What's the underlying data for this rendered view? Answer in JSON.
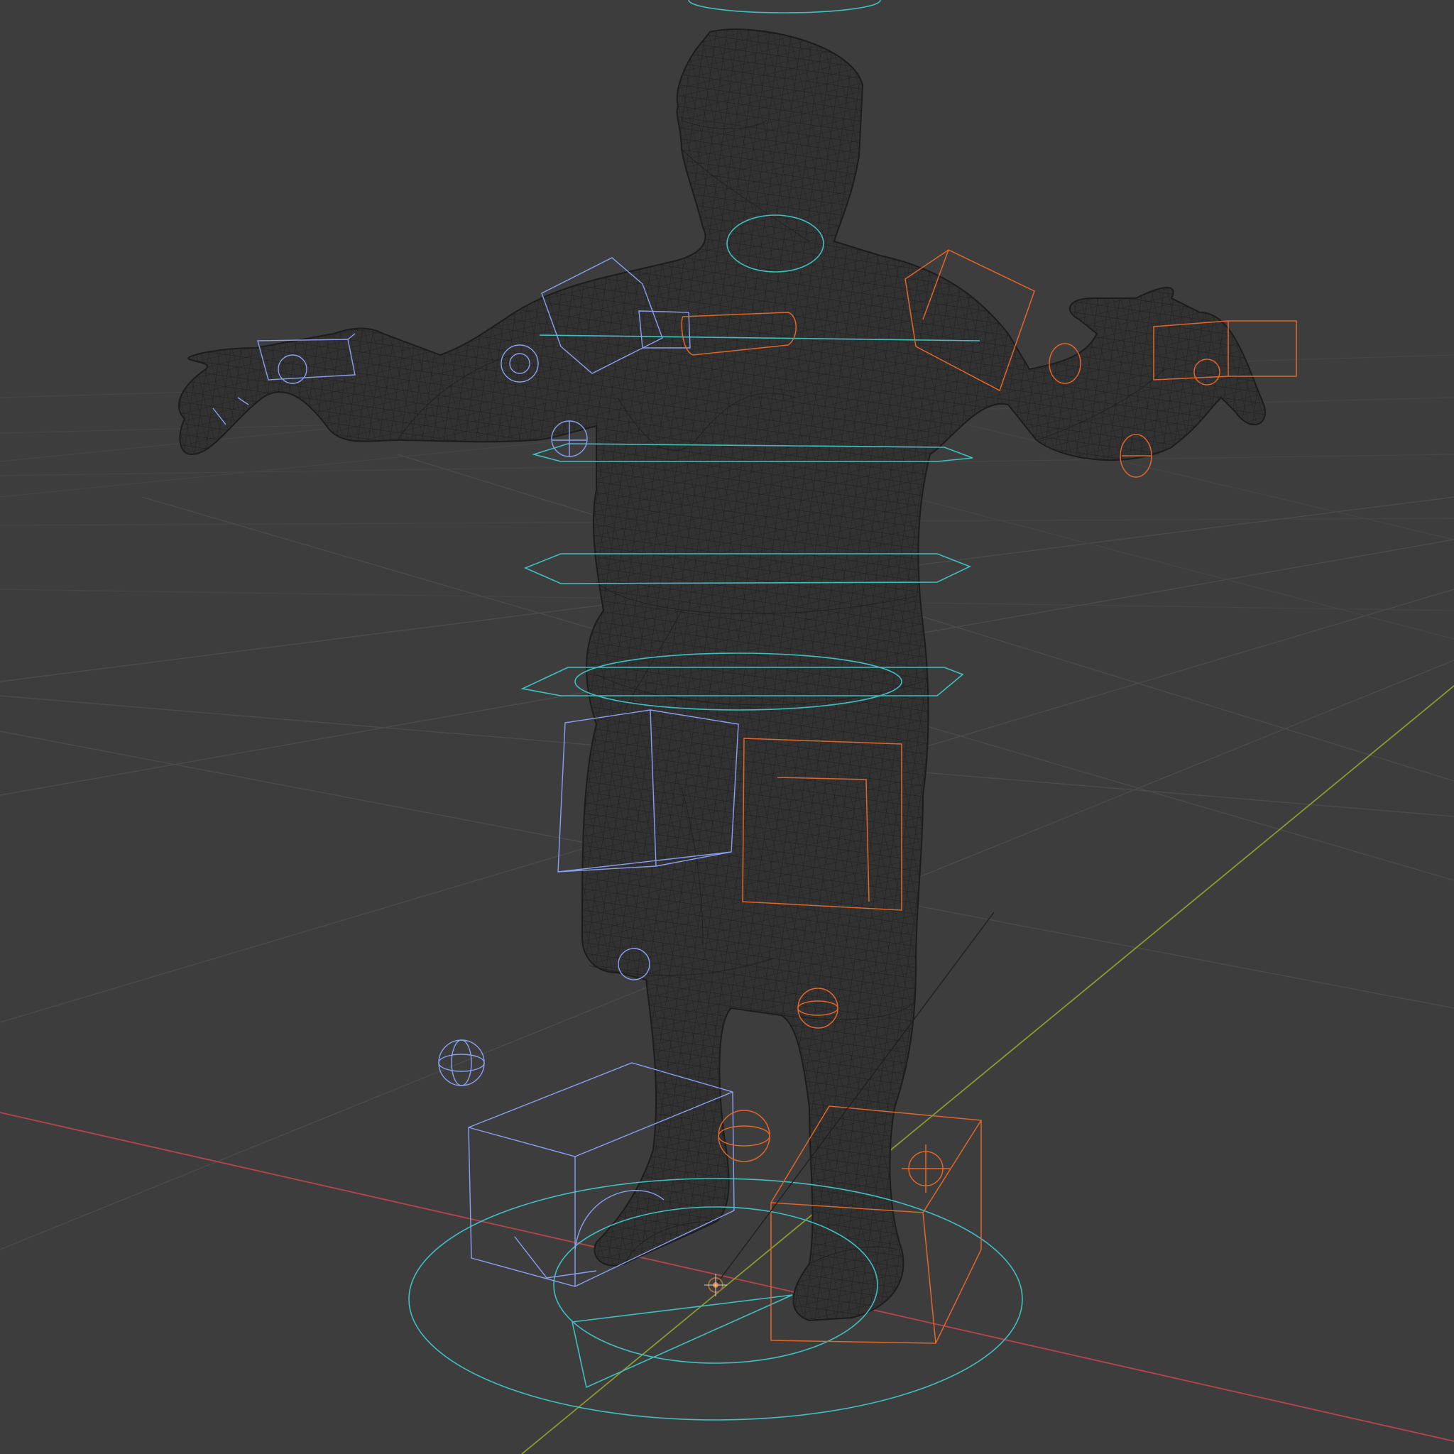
{
  "viewport": {
    "mode": "wireframe",
    "background": "#3d3d3d",
    "grid_color": "#4b4b4b",
    "x_axis_color": "#b5454a",
    "y_axis_color": "#8a9a2e"
  },
  "scene": {
    "object": "character-mesh",
    "rig": {
      "center_color": "#3fbfc0",
      "left_color": "#8aa0ee",
      "right_color": "#e0662a"
    }
  }
}
